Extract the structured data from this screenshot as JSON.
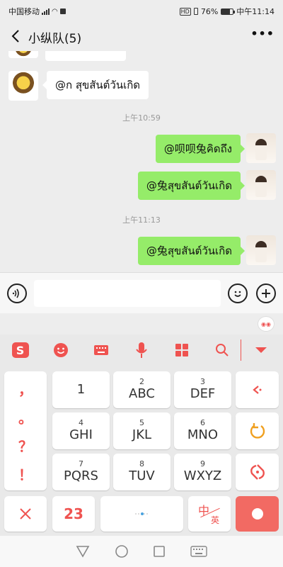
{
  "status": {
    "carrier": "中国移动",
    "battery": "76%",
    "battery_level": 0.76,
    "time": "中午11:14"
  },
  "header": {
    "back_icon": "back-arrow-icon",
    "title": "小纵队(5)",
    "more_label": "•••"
  },
  "messages": [
    {
      "side": "left",
      "text": "@ก สุขสันต์วันเกิด"
    },
    {
      "kind": "time",
      "text": "上午10:59"
    },
    {
      "side": "right",
      "text": "@呗呗兔คิดถึง"
    },
    {
      "side": "right",
      "text": "@兔สุขสันต์วันเกิด"
    },
    {
      "kind": "time",
      "text": "上午11:13"
    },
    {
      "side": "right",
      "text": "@兔สุขสันต์วันเกิด"
    }
  ],
  "input": {
    "placeholder": ""
  },
  "keyboard": {
    "toolbar_icons": [
      "sogou-logo-icon",
      "emoji-icon",
      "keyboard-icon",
      "microphone-icon",
      "apps-icon",
      "search-icon",
      "collapse-icon"
    ],
    "punct": [
      "，",
      "。",
      "？",
      "！"
    ],
    "keys": [
      {
        "n": "",
        "t": "1"
      },
      {
        "n": "2",
        "t": "ABC"
      },
      {
        "n": "3",
        "t": "DEF"
      },
      {
        "n": "4",
        "t": "GHI"
      },
      {
        "n": "5",
        "t": "JKL"
      },
      {
        "n": "6",
        "t": "MNO"
      },
      {
        "n": "7",
        "t": "PQRS"
      },
      {
        "n": "8",
        "t": "TUV"
      },
      {
        "n": "9",
        "t": "WXYZ"
      }
    ],
    "num_key": "23",
    "lang_top": "中",
    "lang_bottom": "英"
  }
}
